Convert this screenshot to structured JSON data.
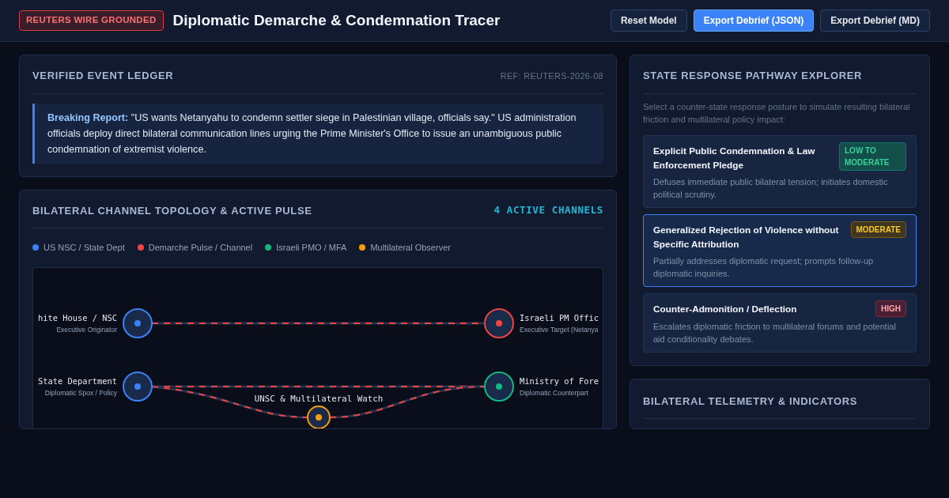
{
  "header": {
    "badge": "REUTERS WIRE GROUNDED",
    "title": "Diplomatic Demarche & Condemnation Tracer",
    "buttons": [
      {
        "label": "Reset Model",
        "kind": "secondary"
      },
      {
        "label": "Export Debrief (JSON)",
        "kind": "primary"
      },
      {
        "label": "Export Debrief (MD)",
        "kind": "secondary"
      }
    ]
  },
  "ledger": {
    "title": "VERIFIED EVENT LEDGER",
    "ref": "REF: REUTERS-2026-08",
    "report": "**Breaking Report:** \"US wants Netanyahu to condemn settler siege in Palestinian village, officials say.\" US administration officials deploy direct bilateral communication lines urging the Prime Minister's Office to issue an unambiguous public condemnation of extremist violence."
  },
  "topology": {
    "title": "BILATERAL CHANNEL TOPOLOGY & ACTIVE PULSE",
    "count": "4 ACTIVE CHANNELS",
    "legend": [
      {
        "label": "US NSC / State Dept",
        "color": "#3b82f6"
      },
      {
        "label": "Demarche Pulse / Channel",
        "color": "#ef4444"
      },
      {
        "label": "Israeli PMO / MFA",
        "color": "#10b981"
      },
      {
        "label": "Multilateral Observer",
        "color": "#f59e0b"
      }
    ],
    "nodes": [
      {
        "kind": "left",
        "label": "hite House / NSC",
        "sublabel": "Executive Originator",
        "color": "#3b82f6"
      },
      {
        "kind": "left",
        "label": "State Department",
        "sublabel": "Diplomatic Spox / Policy",
        "color": "#3b82f6"
      },
      {
        "kind": "right",
        "label": "Israeli PM Offic",
        "sublabel": "Executive Target (Netanya",
        "color": "#ef4444"
      },
      {
        "kind": "right",
        "label": "Ministry of Fore",
        "sublabel": "Diplomatic Counterpart",
        "color": "#10b981"
      },
      {
        "kind": "center",
        "label": "UNSC & Multilateral Watch",
        "color": "#f59e0b"
      }
    ]
  },
  "pathways": {
    "title": "STATE RESPONSE PATHWAY EXPLORER",
    "intro": "Select a counter-state response posture to simulate resulting bilateral friction and multilateral policy impact:",
    "options": [
      {
        "title": "Explicit Public Condemnation & Law Enforcement Pledge",
        "badge": "LOW TO MODERATE",
        "kind": "low",
        "description": "Defuses immediate public bilateral tension; initiates domestic political scrutiny.",
        "selected": false
      },
      {
        "title": "Generalized Rejection of Violence without Specific Attribution",
        "badge": "MODERATE",
        "kind": "moderate",
        "description": "Partially addresses diplomatic request; prompts follow-up diplomatic inquiries.",
        "selected": true
      },
      {
        "title": "Counter-Admonition / Deflection",
        "badge": "HIGH",
        "kind": "high",
        "description": "Escalates diplomatic friction to multilateral forums and potential aid conditionality debates.",
        "selected": false
      }
    ]
  },
  "telemetry": {
    "title": "BILATERAL TELEMETRY & INDICATORS"
  }
}
